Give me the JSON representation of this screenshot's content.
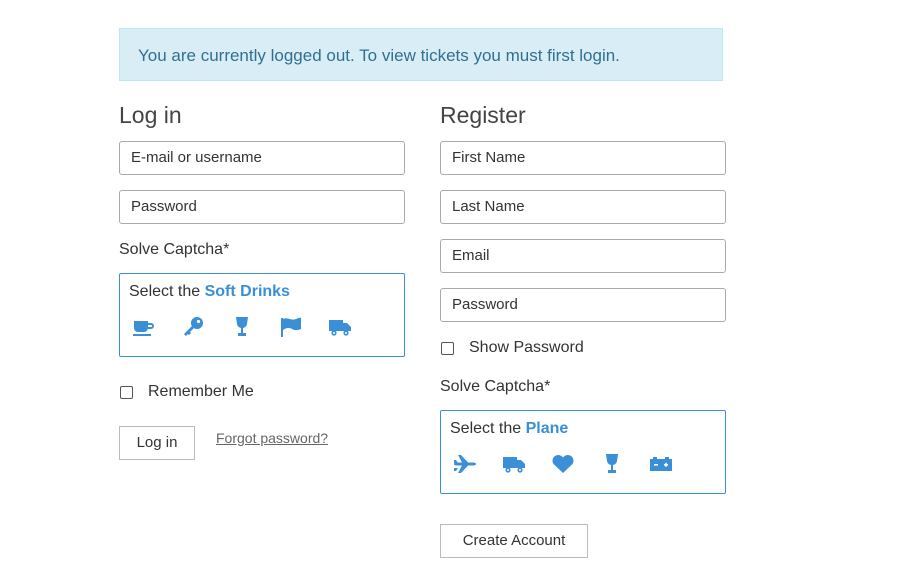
{
  "notice": "You are currently logged out. To view tickets you must first login.",
  "login": {
    "heading": "Log in",
    "username_placeholder": "E-mail or username",
    "password_placeholder": "Password",
    "captcha_label": "Solve Captcha*",
    "captcha_prompt": "Select the",
    "captcha_target": "Soft Drinks",
    "captcha_icons": [
      "coffee-cup-icon",
      "key-icon",
      "wine-glass-icon",
      "flag-icon",
      "truck-icon"
    ],
    "remember_label": "Remember Me",
    "login_button": "Log in",
    "forgot_link": "Forgot password?"
  },
  "register": {
    "heading": "Register",
    "first_name_placeholder": "First Name",
    "last_name_placeholder": "Last Name",
    "email_placeholder": "Email",
    "password_placeholder": "Password",
    "show_password_label": "Show Password",
    "captcha_label": "Solve Captcha*",
    "captcha_prompt": "Select the",
    "captcha_target": "Plane",
    "captcha_icons": [
      "plane-icon",
      "truck-icon",
      "heart-icon",
      "wine-glass-icon",
      "battery-icon"
    ],
    "create_button": "Create Account"
  },
  "colors": {
    "accent": "#3a8fd6",
    "notice_bg": "#d9edf7",
    "notice_text": "#31708f"
  }
}
